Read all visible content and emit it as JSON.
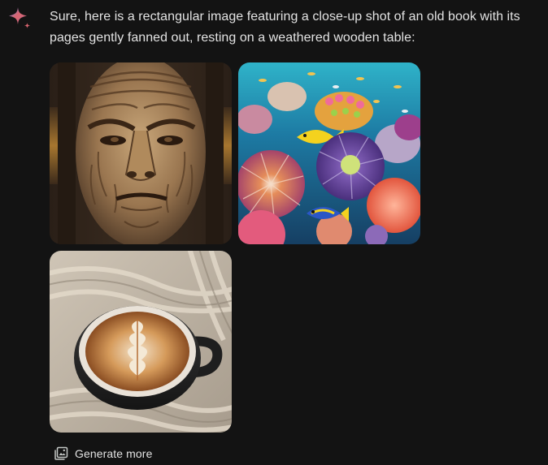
{
  "response": {
    "message": "Sure, here is a rectangular image featuring a close-up shot of an old book with its pages gently fanned out, resting on a weathered wooden table:"
  },
  "images": [
    {
      "subject": "carved-wooden-face"
    },
    {
      "subject": "coral-reef-fish"
    },
    {
      "subject": "latte-art-cup-on-knit-sweater"
    }
  ],
  "actions": {
    "generate_more_label": "Generate more",
    "generate_more_icon": "image-stack-icon"
  },
  "colors": {
    "background": "#131313",
    "text": "#e3e3e3",
    "spark_gradient_start": "#d96570",
    "spark_gradient_end": "#9b72cb"
  }
}
